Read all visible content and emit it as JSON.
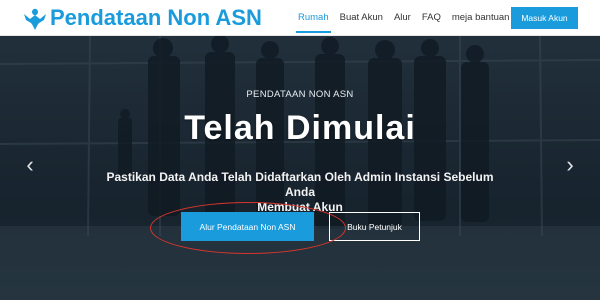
{
  "header": {
    "brand": "Pendataan Non ASN",
    "nav": [
      {
        "label": "Rumah",
        "active": true
      },
      {
        "label": "Buat Akun",
        "active": false
      },
      {
        "label": "Alur",
        "active": false
      },
      {
        "label": "FAQ",
        "active": false
      },
      {
        "label": "meja bantuan",
        "active": false
      }
    ],
    "login_label": "Masuk Akun"
  },
  "hero": {
    "eyebrow": "PENDATAAN NON ASN",
    "title": "Telah Dimulai",
    "subtitle_line1": "Pastikan Data Anda Telah Didaftarkan Oleh Admin Instansi Sebelum Anda",
    "subtitle_line2": "Membuat Akun",
    "primary_button": "Alur Pendataan Non ASN",
    "secondary_button": "Buku Petunjuk",
    "prev_icon": "chevron-left-icon",
    "next_icon": "chevron-right-icon"
  },
  "colors": {
    "accent": "#1a9bdc",
    "highlight": "#d8352c"
  }
}
